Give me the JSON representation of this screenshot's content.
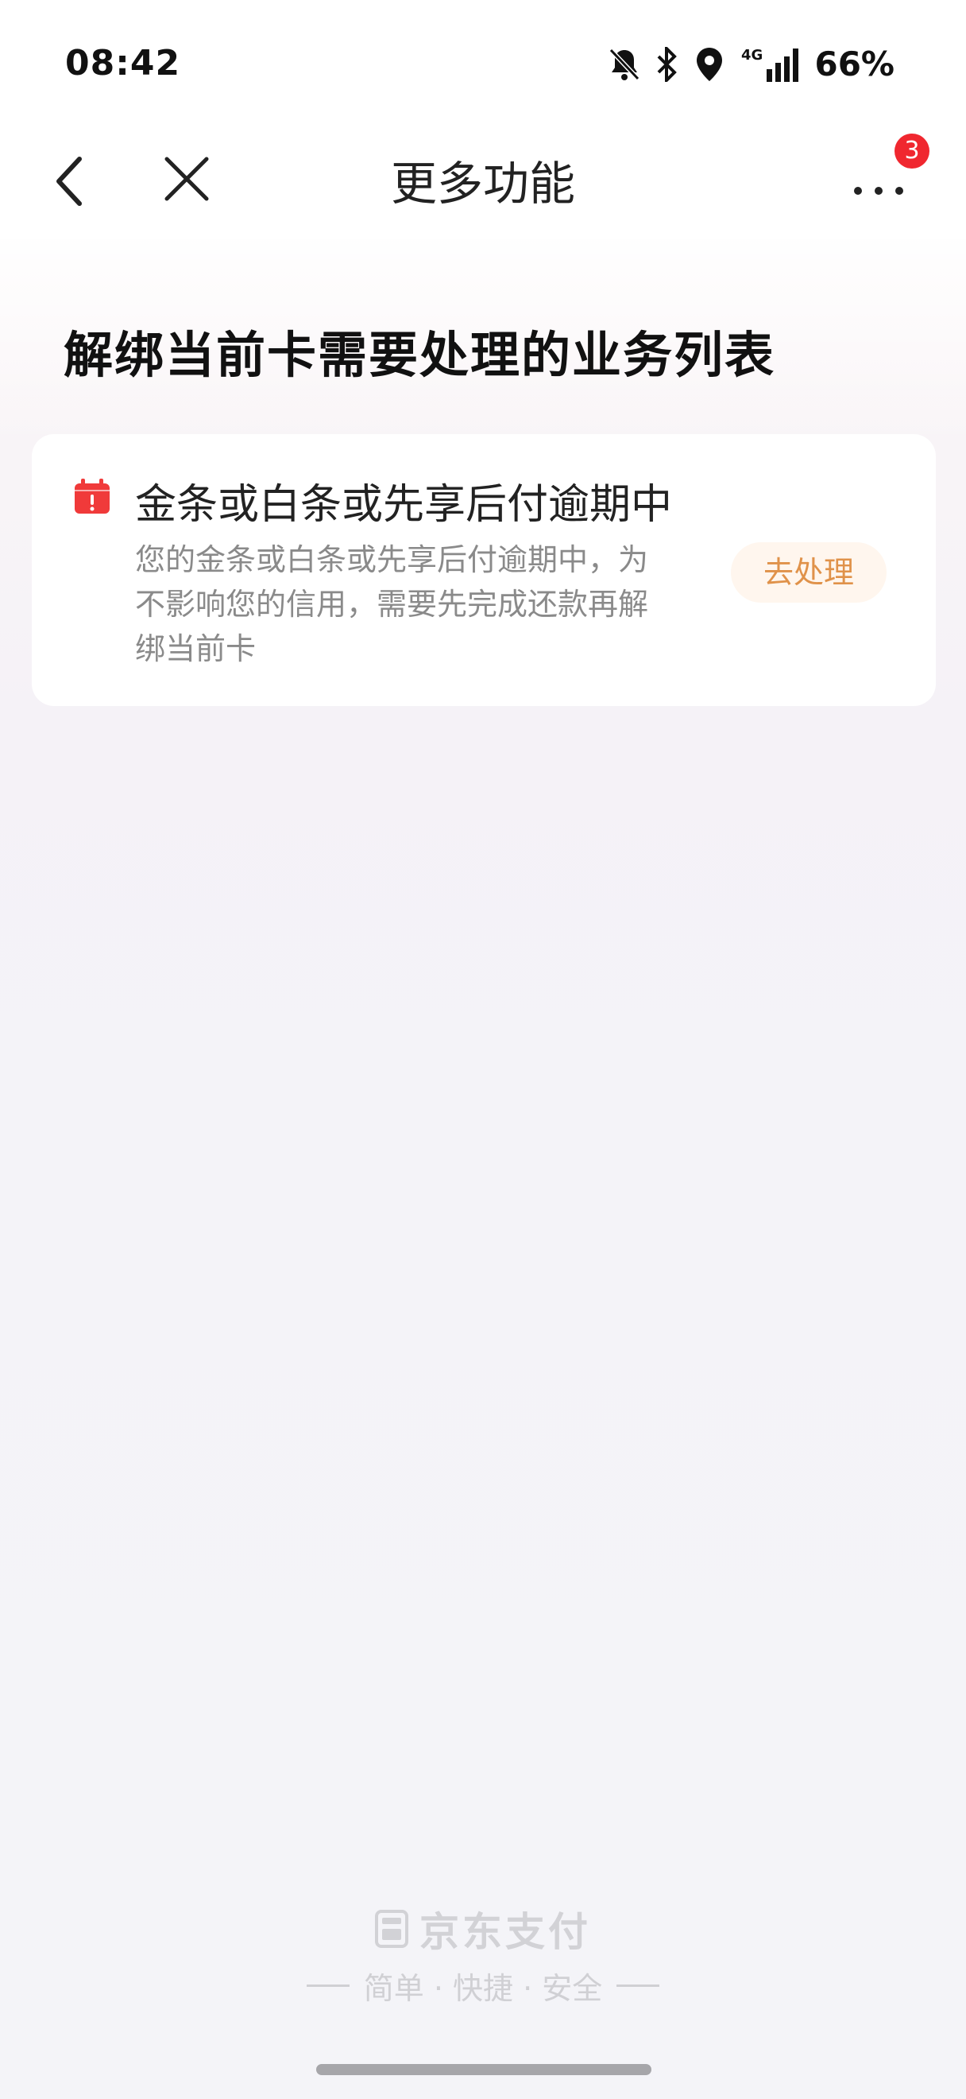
{
  "status_bar": {
    "time": "08:42",
    "network": "4G",
    "battery": "66%",
    "icons": [
      "bell-off-icon",
      "bluetooth-icon",
      "location-icon",
      "signal-icon"
    ]
  },
  "nav": {
    "title": "更多功能",
    "badge_count": "3",
    "icons": [
      "back-arrow-icon",
      "close-icon",
      "more-dots-icon"
    ]
  },
  "section": {
    "title": "解绑当前卡需要处理的业务列表"
  },
  "card": {
    "icon": "calendar-alert-icon",
    "title": "金条或白条或先享后付逾期中",
    "description": "您的金条或白条或先享后付逾期中，为不影响您的信用，需要先完成还款再解绑当前卡",
    "action_label": "去处理"
  },
  "footer": {
    "brand_name": "京东支付",
    "slogan": "简单 · 快捷 · 安全"
  },
  "colors": {
    "accent": "#e0924a",
    "badge": "#f0272f",
    "icon_red": "#f03a3a"
  }
}
